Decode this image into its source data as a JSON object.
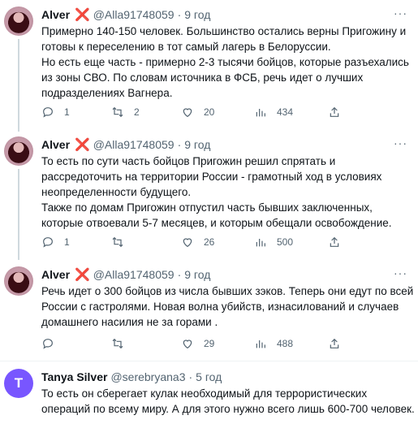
{
  "tweets": [
    {
      "author": "Alver",
      "badge": "❌",
      "handle": "@Alla91748059",
      "sep": "·",
      "time": "9 год",
      "text": "Примерно 140-150 человек. Большинство остались верны Пригожину и готовы к переселению в тот самый лагерь в Белоруссии.\nНо есть еще часть - примерно 2-3 тысячи бойцов, которые разъехались из зоны СВО. По словам источника в ФСБ, речь идет о лучших подразделениях Вагнера.",
      "replies": "1",
      "retweets": "2",
      "likes": "20",
      "views": "434"
    },
    {
      "author": "Alver",
      "badge": "❌",
      "handle": "@Alla91748059",
      "sep": "·",
      "time": "9 год",
      "text": "То есть по сути часть бойцов Пригожин решил спрятать и рассредоточить на территории России - грамотный ход в условиях неопределенности будущего.\nТакже по домам Пригожин отпустил часть бывших заключенных, которые отвоевали 5-7 месяцев, и которым обещали освобождение.",
      "replies": "1",
      "retweets": "",
      "likes": "26",
      "views": "500"
    },
    {
      "author": "Alver",
      "badge": "❌",
      "handle": "@Alla91748059",
      "sep": "·",
      "time": "9 год",
      "text": "Речь идет о 300 бойцов из числа бывших зэков. Теперь они едут по всей России с гастролями. Новая волна убийств, изнасилований и случаев домашнего насилия не за горами .",
      "replies": "",
      "retweets": "",
      "likes": "29",
      "views": "488"
    },
    {
      "author": "Tanya Silver",
      "avatar_letter": "T",
      "handle": "@serebryana3",
      "sep": "·",
      "time": "5 год",
      "text": "То есть он сберегает кулак необходимый для террористических операций по всему миру. А для этого нужно всего лишь 600-700 человек."
    }
  ],
  "colors": {
    "muted": "#536471",
    "accent_avatar": "#7856ff",
    "badge": "#e0245e"
  },
  "icons": [
    "reply-icon",
    "retweet-icon",
    "like-icon",
    "views-icon",
    "share-icon",
    "more-icon"
  ]
}
